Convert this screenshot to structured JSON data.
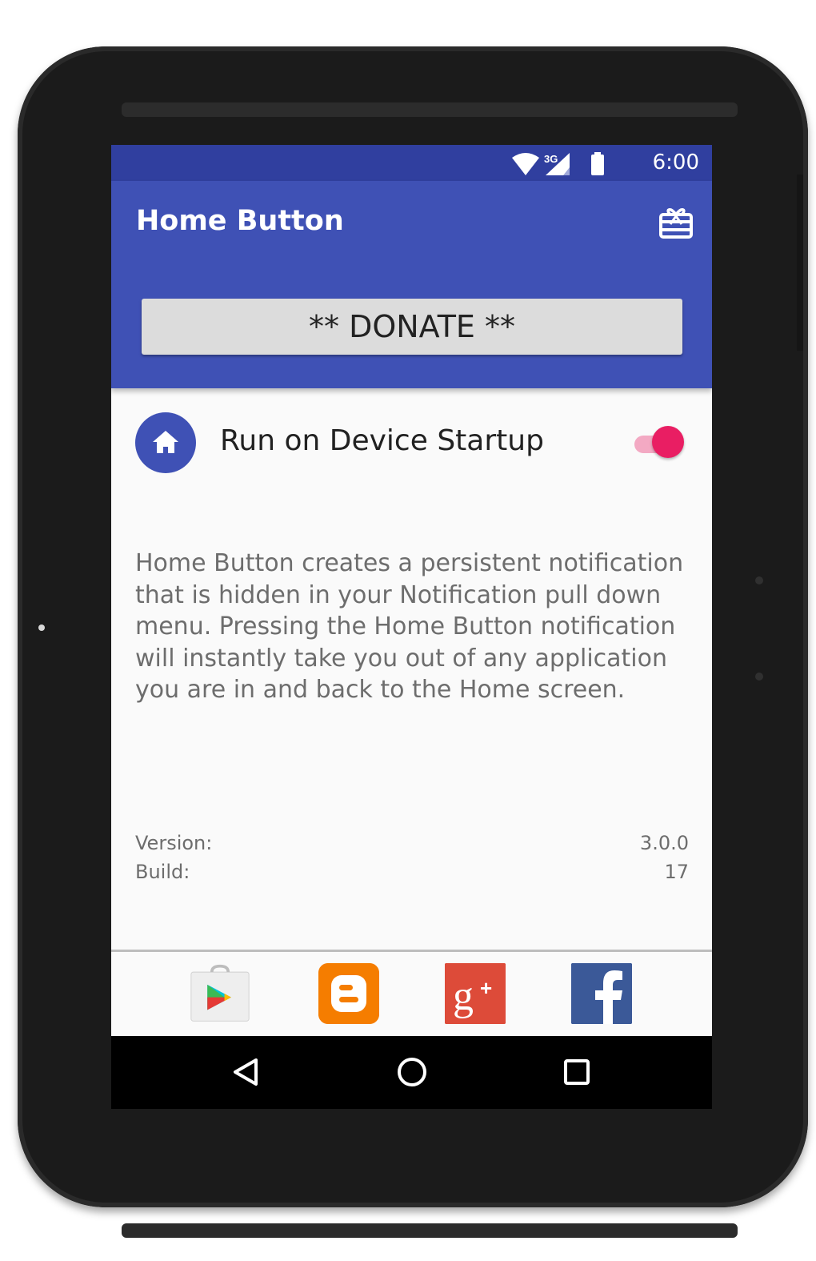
{
  "status_bar": {
    "time": "6:00",
    "network_label": "3G",
    "icons": [
      "wifi-icon",
      "cell-signal-icon",
      "battery-icon"
    ]
  },
  "app_bar": {
    "title": "Home Button",
    "action_icon": "gift-card-icon"
  },
  "donate_button": {
    "label": "** DONATE **"
  },
  "startup_setting": {
    "label": "Run on Device Startup",
    "icon": "home-icon",
    "enabled": true
  },
  "description": "Home Button creates a persistent notification that is hidden in your Notification pull down menu. Pressing the Home Button notification will instantly take you out of any application you are in and back to the Home screen.",
  "info": {
    "version_label": "Version:",
    "version_value": "3.0.0",
    "build_label": "Build:",
    "build_value": "17"
  },
  "social_links": [
    "google-play-icon",
    "blogger-icon",
    "google-plus-icon",
    "facebook-icon"
  ],
  "nav_bar": [
    "back-icon",
    "home-nav-icon",
    "recents-icon"
  ],
  "colors": {
    "status_bar": "#303f9f",
    "primary": "#3f51b5",
    "accent": "#e91e63",
    "donate_bg": "#dcdcdc"
  }
}
